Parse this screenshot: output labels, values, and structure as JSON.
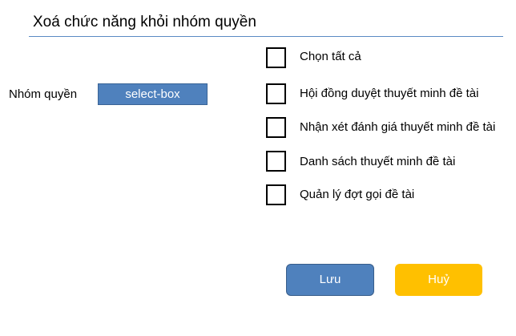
{
  "page": {
    "title": "Xoá chức năng khỏi nhóm quyền"
  },
  "group": {
    "label": "Nhóm quyền",
    "select_value": "select-box"
  },
  "permissions": [
    {
      "label": "Chọn tất cả",
      "checked": false
    },
    {
      "label": "Hội đồng duyệt thuyết minh đề tài",
      "checked": false
    },
    {
      "label": "Nhận xét đánh giá thuyết minh đề tài",
      "checked": false
    },
    {
      "label": "Danh sách thuyết minh đề tài",
      "checked": false
    },
    {
      "label": "Quản lý đợt gọi đề tài",
      "checked": false
    }
  ],
  "actions": {
    "save_label": "Lưu",
    "cancel_label": "Huỷ"
  },
  "colors": {
    "accent_blue": "#4f81bd",
    "cancel_yellow": "#ffc000",
    "rule_blue": "#5b8bc4"
  }
}
